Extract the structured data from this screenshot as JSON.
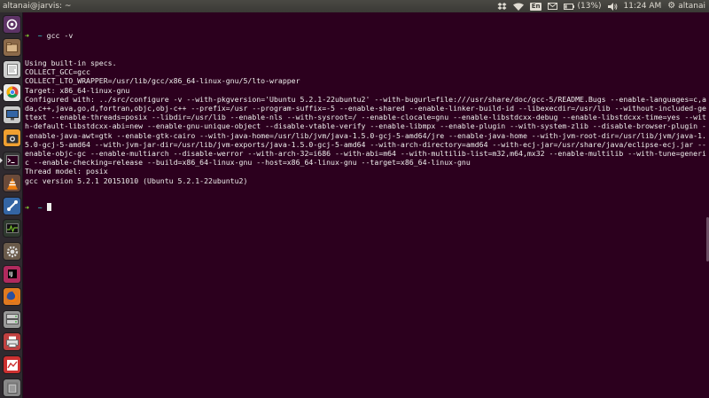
{
  "window": {
    "title": "altanai@jarvis: ~"
  },
  "panel": {
    "lang": "En",
    "battery": "(13%)",
    "time": "11:24 AM",
    "user": "altanai",
    "icons": [
      "dropbox-icon",
      "wifi-icon",
      "keyboard-lang-icon",
      "mail-icon",
      "battery-icon",
      "volume-icon",
      "gear-icon"
    ]
  },
  "launcher": {
    "items": [
      {
        "name": "dash-home-icon",
        "bg": "#5d3366"
      },
      {
        "name": "files-icon",
        "bg": "#8c6a4a"
      },
      {
        "name": "text-editor-icon",
        "bg": "#cfcfcf"
      },
      {
        "name": "chrome-icon",
        "bg": "#e9e9e9"
      },
      {
        "name": "remote-desktop-icon",
        "bg": "#c9c9c9"
      },
      {
        "name": "screenshot-icon",
        "bg": "#f0a030"
      },
      {
        "name": "terminal-icon",
        "bg": "#3a3a3a"
      },
      {
        "name": "vlc-icon",
        "bg": "#6a4a3a"
      },
      {
        "name": "network-icon",
        "bg": "#3465a4"
      },
      {
        "name": "system-monitor-icon",
        "bg": "#2f3a2f"
      },
      {
        "name": "settings-icon",
        "bg": "#6a5a4a"
      },
      {
        "name": "intellij-icon",
        "bg": "#b02a5e"
      },
      {
        "name": "firefox-icon",
        "bg": "#e07a20"
      },
      {
        "name": "disk-manager-icon",
        "bg": "#999999"
      },
      {
        "name": "app-icon-printer",
        "bg": "#c04040"
      },
      {
        "name": "app-icon-red",
        "bg": "#cc3030"
      },
      {
        "name": "trash-icon",
        "bg": "#888888"
      }
    ]
  },
  "terminal": {
    "prompt_dir": "~",
    "command": "gcc -v",
    "output": [
      "Using built-in specs.",
      "COLLECT_GCC=gcc",
      "COLLECT_LTO_WRAPPER=/usr/lib/gcc/x86_64-linux-gnu/5/lto-wrapper",
      "Target: x86_64-linux-gnu",
      "Configured with: ../src/configure -v --with-pkgversion='Ubuntu 5.2.1-22ubuntu2' --with-bugurl=file:///usr/share/doc/gcc-5/README.Bugs --enable-languages=c,ada,c++,java,go,d,fortran,objc,obj-c++ --prefix=/usr --program-suffix=-5 --enable-shared --enable-linker-build-id --libexecdir=/usr/lib --without-included-gettext --enable-threads=posix --libdir=/usr/lib --enable-nls --with-sysroot=/ --enable-clocale=gnu --enable-libstdcxx-debug --enable-libstdcxx-time=yes --with-default-libstdcxx-abi=new --enable-gnu-unique-object --disable-vtable-verify --enable-libmpx --enable-plugin --with-system-zlib --disable-browser-plugin --enable-java-awt=gtk --enable-gtk-cairo --with-java-home=/usr/lib/jvm/java-1.5.0-gcj-5-amd64/jre --enable-java-home --with-jvm-root-dir=/usr/lib/jvm/java-1.5.0-gcj-5-amd64 --with-jvm-jar-dir=/usr/lib/jvm-exports/java-1.5.0-gcj-5-amd64 --with-arch-directory=amd64 --with-ecj-jar=/usr/share/java/eclipse-ecj.jar --enable-objc-gc --enable-multiarch --disable-werror --with-arch-32=i686 --with-abi=m64 --with-multilib-list=m32,m64,mx32 --enable-multilib --with-tune=generic --enable-checking=release --build=x86_64-linux-gnu --host=x86_64-linux-gnu --target=x86_64-linux-gnu",
      "Thread model: posix",
      "gcc version 5.2.1 20151010 (Ubuntu 5.2.1-22ubuntu2)"
    ]
  },
  "colors": {
    "terminal_bg": "#2c001e",
    "prompt_arrow": "#8ae234",
    "prompt_dir": "#34e2e2",
    "text": "#eeeeec"
  }
}
